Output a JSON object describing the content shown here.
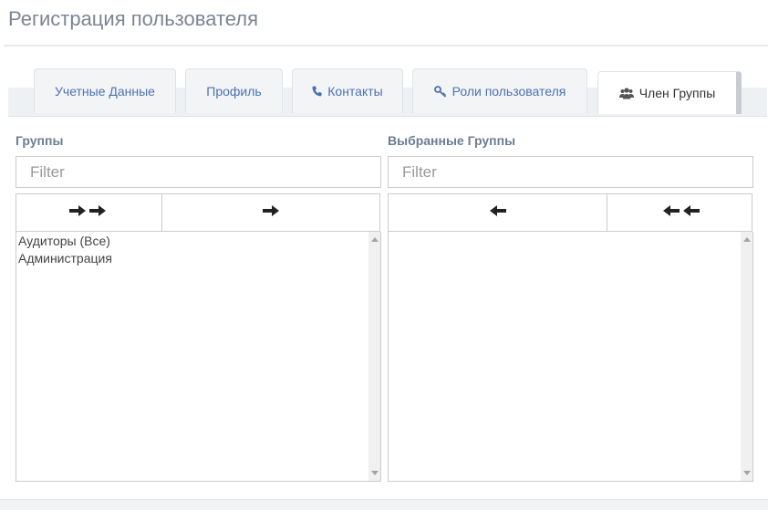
{
  "page": {
    "title": "Регистрация пользователя"
  },
  "tabs": [
    {
      "label": "Учетные Данные",
      "icon": ""
    },
    {
      "label": "Профиль",
      "icon": ""
    },
    {
      "label": "Контакты",
      "icon": "phone-icon"
    },
    {
      "label": "Роли пользователя",
      "icon": "key-icon"
    },
    {
      "label": "Член Группы",
      "icon": "users-icon",
      "active": true
    }
  ],
  "available": {
    "label": "Группы",
    "filter_placeholder": "Filter",
    "buttons": [
      "move-all-right-icon",
      "move-right-icon"
    ],
    "items": [
      "Аудиторы (Все)",
      "Администрация"
    ]
  },
  "selected": {
    "label": "Выбранные Группы",
    "filter_placeholder": "Filter",
    "buttons": [
      "move-left-icon",
      "move-all-left-icon"
    ],
    "items": []
  },
  "colors": {
    "accent": "#4b72b0",
    "title": "#7b8594",
    "label": "#6b7c93",
    "border": "#c9ccd1",
    "tabbar": "#eef1f4"
  }
}
